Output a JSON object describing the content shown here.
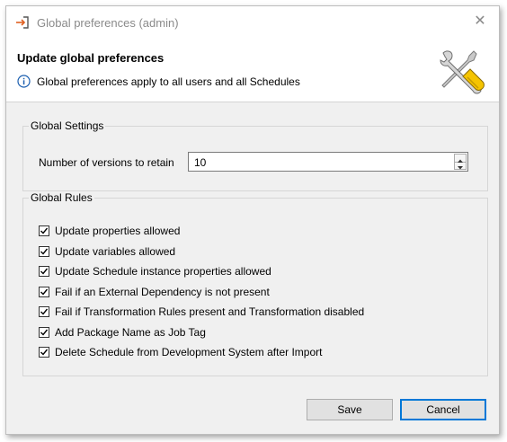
{
  "window": {
    "title": "Global preferences (admin)"
  },
  "header": {
    "heading": "Update global preferences",
    "info": "Global preferences apply to all users and all Schedules"
  },
  "global_settings": {
    "legend": "Global Settings",
    "versions_label": "Number of versions to retain",
    "versions_value": "10"
  },
  "global_rules": {
    "legend": "Global Rules",
    "items": [
      {
        "label": "Update properties allowed",
        "checked": true
      },
      {
        "label": "Update variables allowed",
        "checked": true
      },
      {
        "label": "Update Schedule instance properties allowed",
        "checked": true
      },
      {
        "label": "Fail if an External Dependency is not present",
        "checked": true
      },
      {
        "label": "Fail if Transformation Rules present and Transformation disabled",
        "checked": true
      },
      {
        "label": "Add Package Name as Job Tag",
        "checked": true
      },
      {
        "label": "Delete Schedule from Development System after Import",
        "checked": true
      }
    ]
  },
  "buttons": {
    "save": "Save",
    "cancel": "Cancel"
  },
  "colors": {
    "dialog_bg": "#f0f0f0",
    "accent": "#0078d7"
  }
}
